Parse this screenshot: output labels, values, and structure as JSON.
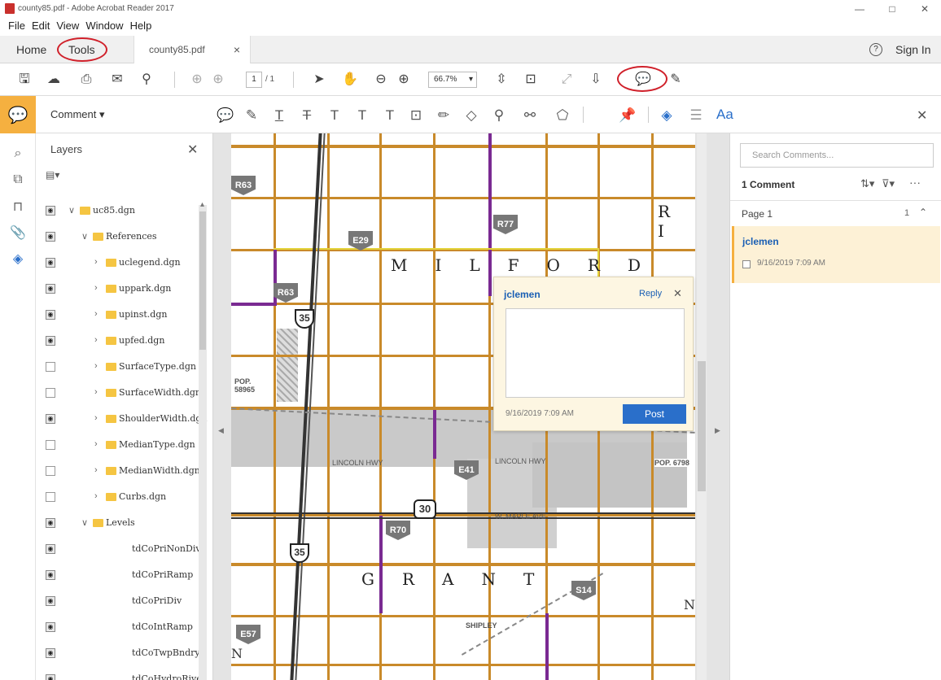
{
  "window": {
    "title": "county85.pdf - Adobe Acrobat Reader 2017",
    "min": "—",
    "max": "□",
    "close": "✕"
  },
  "menu": [
    "File",
    "Edit",
    "View",
    "Window",
    "Help"
  ],
  "tabs": {
    "home": "Home",
    "tools": "Tools",
    "file": "county85.pdf",
    "file_close": "×",
    "help": "?",
    "signin": "Sign In"
  },
  "toolbar": {
    "page_current": "1",
    "page_total": "/ 1",
    "zoom": "66.7%"
  },
  "commentbar": {
    "label": "Comment ▾",
    "font_label": "Aa",
    "close": "✕"
  },
  "layers": {
    "title": "Layers",
    "close": "✕",
    "options": "▤▾",
    "items": [
      {
        "name": "uc85.dgn",
        "visible": true,
        "indent": 0,
        "folder": true,
        "expanded": true
      },
      {
        "name": "References",
        "visible": true,
        "indent": 1,
        "folder": true,
        "expanded": true
      },
      {
        "name": "uclegend.dgn",
        "visible": true,
        "indent": 2,
        "folder": true,
        "expanded": false
      },
      {
        "name": "uppark.dgn",
        "visible": true,
        "indent": 2,
        "folder": true,
        "expanded": false
      },
      {
        "name": "upinst.dgn",
        "visible": true,
        "indent": 2,
        "folder": true,
        "expanded": false
      },
      {
        "name": "upfed.dgn",
        "visible": true,
        "indent": 2,
        "folder": true,
        "expanded": false
      },
      {
        "name": "SurfaceType.dgn",
        "visible": false,
        "indent": 2,
        "folder": true,
        "expanded": false
      },
      {
        "name": "SurfaceWidth.dgn",
        "visible": false,
        "indent": 2,
        "folder": true,
        "expanded": false
      },
      {
        "name": "ShoulderWidth.dgn",
        "visible": true,
        "indent": 2,
        "folder": true,
        "expanded": false
      },
      {
        "name": "MedianType.dgn",
        "visible": false,
        "indent": 2,
        "folder": true,
        "expanded": false
      },
      {
        "name": "MedianWidth.dgn",
        "visible": false,
        "indent": 2,
        "folder": true,
        "expanded": false
      },
      {
        "name": "Curbs.dgn",
        "visible": false,
        "indent": 2,
        "folder": true,
        "expanded": false
      },
      {
        "name": "Levels",
        "visible": true,
        "indent": 1,
        "folder": true,
        "expanded": true
      },
      {
        "name": "tdCoPriNonDiv",
        "visible": true,
        "indent": 3,
        "folder": false
      },
      {
        "name": "tdCoPriRamp",
        "visible": true,
        "indent": 3,
        "folder": false
      },
      {
        "name": "tdCoPriDiv",
        "visible": true,
        "indent": 3,
        "folder": false
      },
      {
        "name": "tdCoIntRamp",
        "visible": true,
        "indent": 3,
        "folder": false
      },
      {
        "name": "tdCoTwpBndry",
        "visible": true,
        "indent": 3,
        "folder": false
      },
      {
        "name": "tdCoHydroRiver",
        "visible": true,
        "indent": 3,
        "folder": false
      }
    ]
  },
  "map": {
    "town1": "MILFORD",
    "town2": "GRANT",
    "corner_letters": "R I",
    "label_n": "N",
    "label_n2": "N",
    "shields": [
      "E29",
      "R63",
      "R77",
      "E41",
      "R70",
      "S14",
      "E57",
      "R63"
    ],
    "interstate": "35",
    "interstate2": "35",
    "us": "30",
    "labels": {
      "lincoln1": "LINCOLN HWY",
      "lincoln2": "LINCOLN HWY",
      "maple": "W. MAPLE AVE",
      "shipley": "SHIPLEY",
      "pop": "POP. 6798",
      "pop2": "POP. 58965"
    }
  },
  "popup": {
    "author": "jclemen",
    "reply": "Reply",
    "close": "✕",
    "date": "9/16/2019 7:09 AM",
    "post": "Post"
  },
  "comments": {
    "search_placeholder": "Search Comments...",
    "count": "1 Comment",
    "page_label": "Page 1",
    "page_count": "1",
    "item_author": "jclemen",
    "item_date": "9/16/2019 7:09 AM"
  }
}
